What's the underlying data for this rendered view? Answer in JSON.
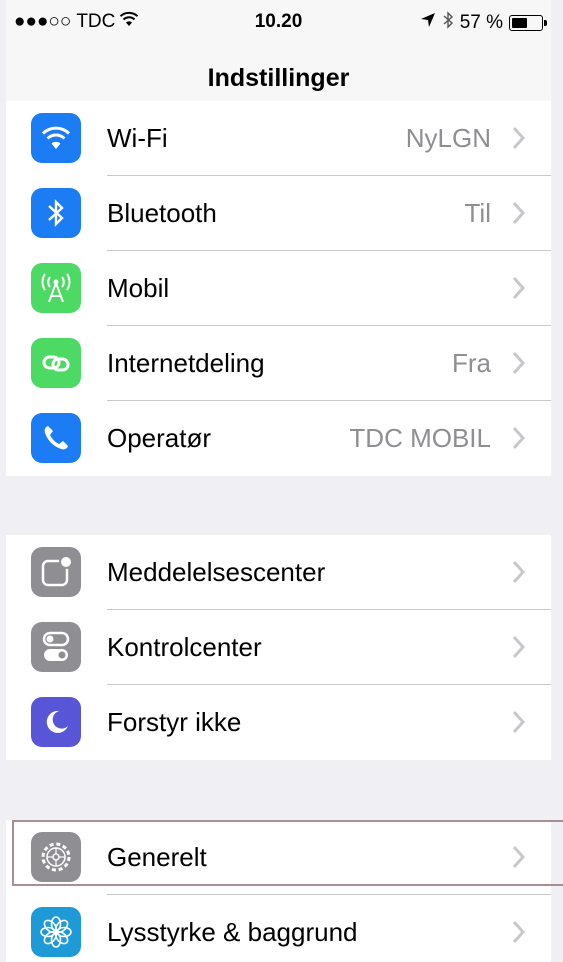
{
  "status_bar": {
    "carrier": "●●●○○ TDC",
    "time": "10.20",
    "battery_percent": "57 %",
    "battery_level": 0.57,
    "icons": [
      "wifi-icon",
      "location-arrow-icon",
      "bluetooth-icon",
      "battery-icon"
    ]
  },
  "nav": {
    "title": "Indstillinger"
  },
  "groups": [
    {
      "items": [
        {
          "label": "Wi-Fi",
          "value": "NyLGN",
          "icon": "wifi-icon",
          "color": "#1b7cf4"
        },
        {
          "label": "Bluetooth",
          "value": "Til",
          "icon": "bluetooth-icon",
          "color": "#1b7cf4"
        },
        {
          "label": "Mobil",
          "value": "",
          "icon": "antenna-icon",
          "color": "#4cd964"
        },
        {
          "label": "Internetdeling",
          "value": "Fra",
          "icon": "personal-hotspot-icon",
          "color": "#4cd964"
        },
        {
          "label": "Operatør",
          "value": "TDC MOBIL",
          "icon": "phone-icon",
          "color": "#1b7cf4"
        }
      ]
    },
    {
      "items": [
        {
          "label": "Meddelelsescenter",
          "value": "",
          "icon": "notification-center-icon",
          "color": "#8e8e93"
        },
        {
          "label": "Kontrolcenter",
          "value": "",
          "icon": "control-center-icon",
          "color": "#8e8e93"
        },
        {
          "label": "Forstyr ikke",
          "value": "",
          "icon": "moon-icon",
          "color": "#5856d6"
        }
      ]
    },
    {
      "items": [
        {
          "label": "Generelt",
          "value": "",
          "icon": "gear-icon",
          "color": "#8e8e93",
          "highlighted": true
        },
        {
          "label": "Lysstyrke & baggrund",
          "value": "",
          "icon": "flower-icon",
          "color": "#1e9bd7"
        }
      ]
    }
  ]
}
